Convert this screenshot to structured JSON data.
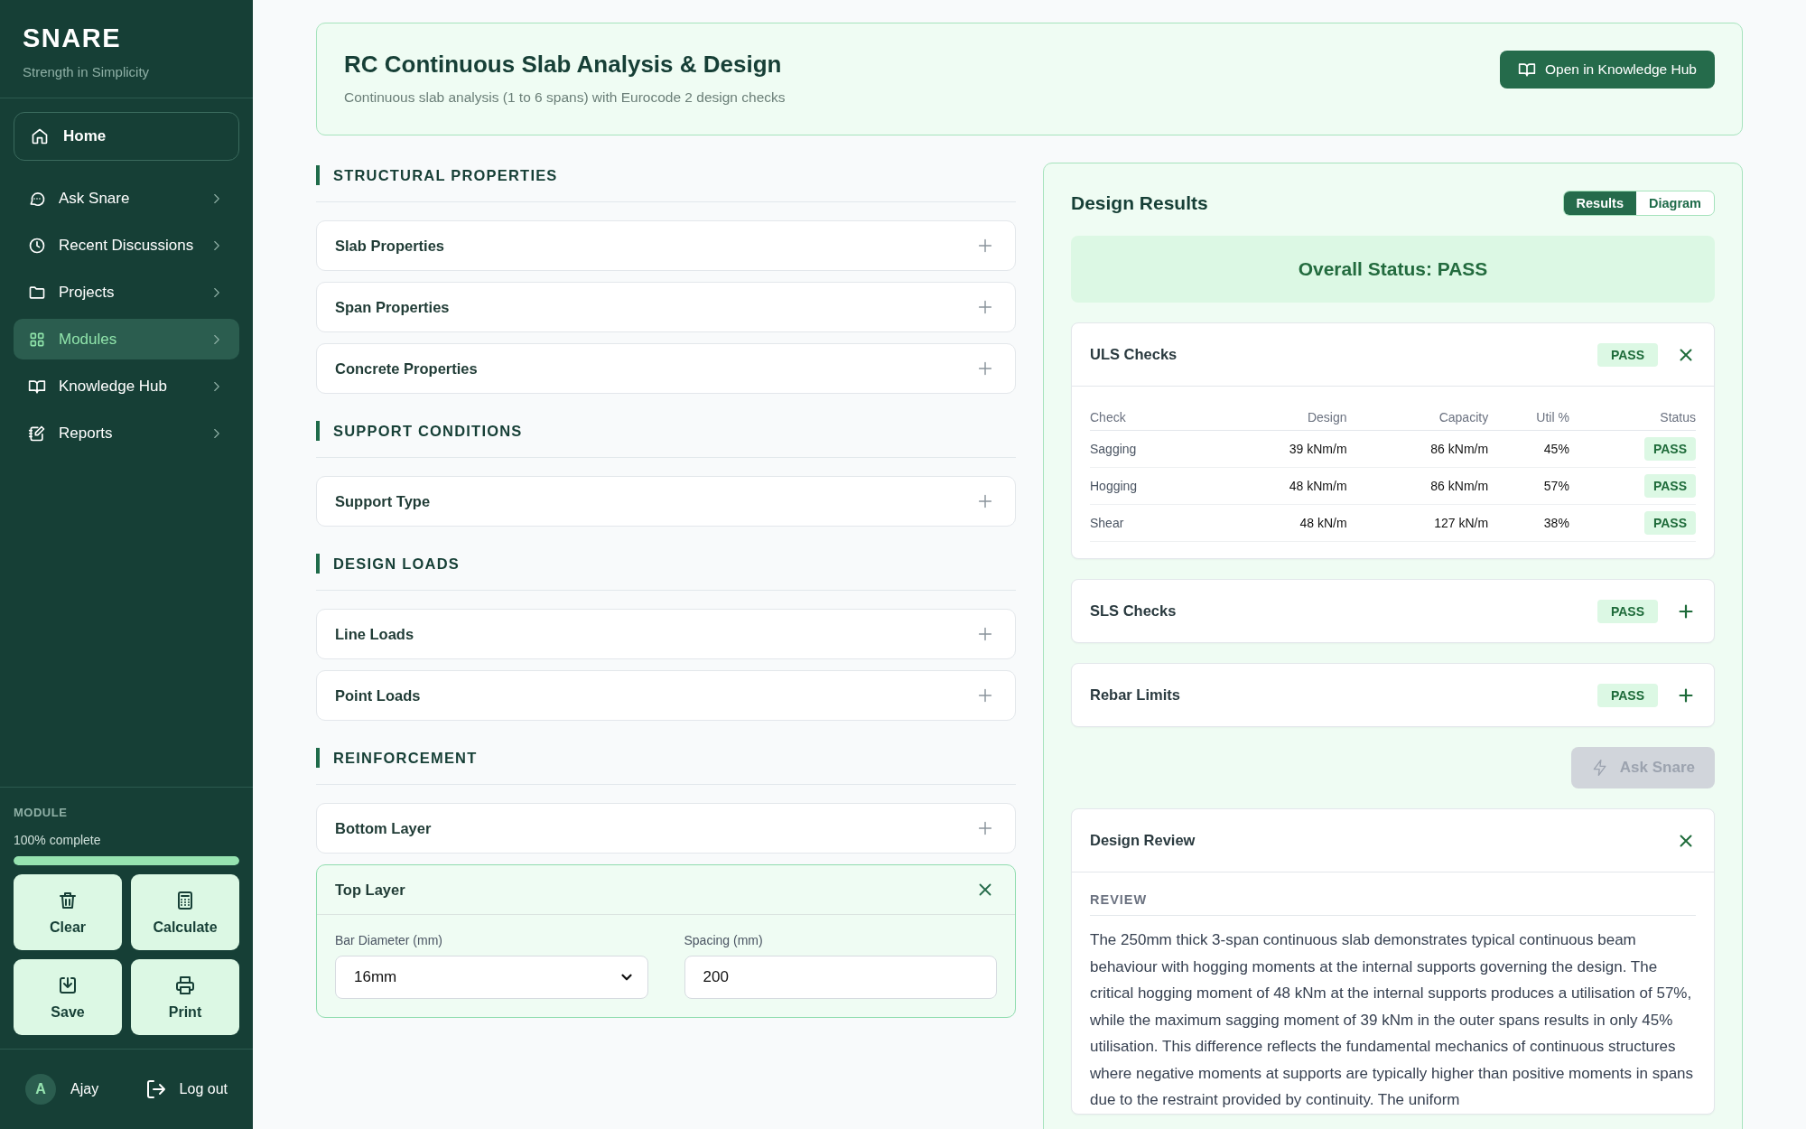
{
  "sidebar": {
    "brand": "SNARE",
    "tagline": "Strength in Simplicity",
    "nav": [
      {
        "label": "Home",
        "kind": "home",
        "selected": false
      },
      {
        "label": "Ask Snare",
        "kind": "link",
        "selected": false
      },
      {
        "label": "Recent Discussions",
        "kind": "link",
        "selected": false
      },
      {
        "label": "Projects",
        "kind": "link",
        "selected": false
      },
      {
        "label": "Modules",
        "kind": "link",
        "selected": true
      },
      {
        "label": "Knowledge Hub",
        "kind": "link",
        "selected": false
      },
      {
        "label": "Reports",
        "kind": "link",
        "selected": false
      }
    ],
    "module": {
      "label": "MODULE",
      "progress_text": "100% complete",
      "level": 1
    },
    "actions": [
      "Clear",
      "Calculate",
      "Save",
      "Print"
    ],
    "user": {
      "initial": "A",
      "name": "Ajay",
      "logout": "Log out"
    }
  },
  "header": {
    "title": "RC Continuous Slab Analysis & Design",
    "subtitle": "Continuous slab analysis (1 to 6 spans) with Eurocode 2 design checks",
    "button": "Open in Knowledge Hub"
  },
  "sections": [
    {
      "heading": "STRUCTURAL PROPERTIES",
      "panels": [
        {
          "title": "Slab Properties",
          "expanded": false
        },
        {
          "title": "Span Properties",
          "expanded": false
        },
        {
          "title": "Concrete Properties",
          "expanded": false
        }
      ]
    },
    {
      "heading": "SUPPORT CONDITIONS",
      "panels": [
        {
          "title": "Support Type",
          "expanded": false
        }
      ]
    },
    {
      "heading": "DESIGN LOADS",
      "panels": [
        {
          "title": "Line Loads",
          "expanded": false
        },
        {
          "title": "Point Loads",
          "expanded": false
        }
      ]
    },
    {
      "heading": "REINFORCEMENT",
      "panels": [
        {
          "title": "Bottom Layer",
          "expanded": false
        },
        {
          "title": "Top Layer",
          "expanded": true,
          "fields": [
            {
              "label": "Bar Diameter (mm)",
              "kind": "select",
              "value": "16mm"
            },
            {
              "label": "Spacing (mm)",
              "kind": "input",
              "value": "200"
            }
          ]
        }
      ]
    }
  ],
  "results": {
    "title": "Design Results",
    "tabs": [
      {
        "label": "Results",
        "selected": true
      },
      {
        "label": "Diagram",
        "selected": false
      }
    ],
    "overall": "Overall Status: PASS",
    "checks": [
      {
        "title": "ULS Checks",
        "badge": "PASS",
        "expanded": true,
        "table": {
          "columns": [
            "Check",
            "Design",
            "Capacity",
            "Util %",
            "Status"
          ],
          "rows": [
            [
              "Sagging",
              "39 kNm/m",
              "86 kNm/m",
              "45%",
              "PASS"
            ],
            [
              "Hogging",
              "48 kNm/m",
              "86 kNm/m",
              "57%",
              "PASS"
            ],
            [
              "Shear",
              "48 kN/m",
              "127 kN/m",
              "38%",
              "PASS"
            ]
          ]
        }
      },
      {
        "title": "SLS Checks",
        "badge": "PASS",
        "expanded": false
      },
      {
        "title": "Rebar Limits",
        "badge": "PASS",
        "expanded": false
      }
    ],
    "ask_button": {
      "label": "Ask Snare",
      "disabled": true
    },
    "review": {
      "title": "Design Review",
      "expanded": true,
      "heading": "REVIEW",
      "text": "The 250mm thick 3-span continuous slab demonstrates typical continuous beam behaviour with hogging moments at the internal supports governing the design. The critical hogging moment of 48 kNm at the internal supports produces a utilisation of 57%, while the maximum sagging moment of 39 kNm in the outer spans results in only 45% utilisation. This difference reflects the fundamental mechanics of continuous structures where negative moments at supports are typically higher than positive moments in spans due to the restraint provided by continuity. The uniform"
    }
  }
}
